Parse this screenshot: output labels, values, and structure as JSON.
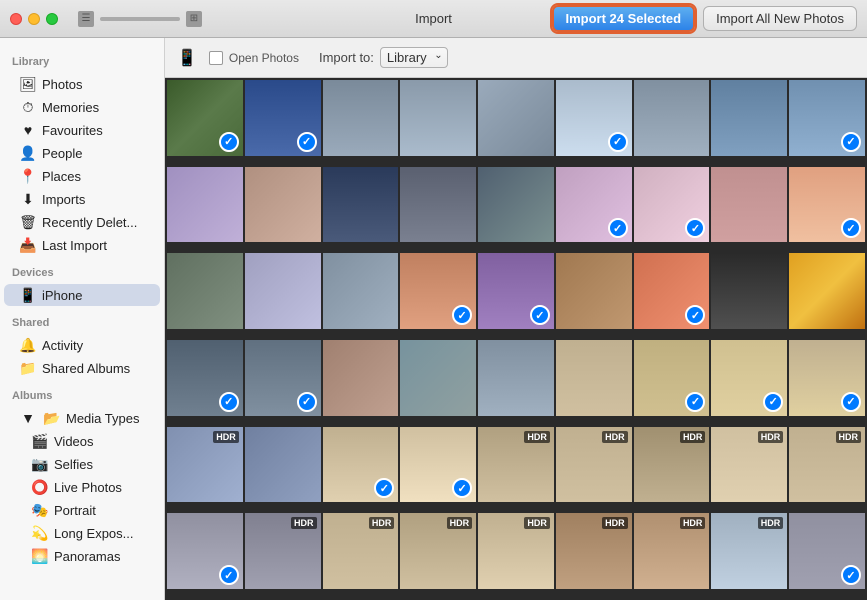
{
  "titlebar": {
    "title": "Import",
    "btn_import_selected": "Import 24 Selected",
    "btn_import_all": "Import All New Photos"
  },
  "toolbar": {
    "open_photos_label": "Open Photos",
    "import_to_label": "Import to:",
    "import_to_value": "Library",
    "device_label": "iPhone"
  },
  "sidebar": {
    "library_header": "Library",
    "library_items": [
      {
        "id": "photos",
        "icon": "🖼",
        "label": "Photos"
      },
      {
        "id": "memories",
        "icon": "⏱",
        "label": "Memories"
      },
      {
        "id": "favourites",
        "icon": "♥",
        "label": "Favourites"
      },
      {
        "id": "people",
        "icon": "👤",
        "label": "People"
      },
      {
        "id": "places",
        "icon": "📍",
        "label": "Places"
      },
      {
        "id": "imports",
        "icon": "⬇",
        "label": "Imports"
      },
      {
        "id": "recently-deleted",
        "icon": "🗑",
        "label": "Recently Delet..."
      },
      {
        "id": "last-import",
        "icon": "📥",
        "label": "Last Import"
      }
    ],
    "devices_header": "Devices",
    "device_items": [
      {
        "id": "iphone",
        "icon": "📱",
        "label": "iPhone"
      }
    ],
    "shared_header": "Shared",
    "shared_items": [
      {
        "id": "activity",
        "icon": "🔔",
        "label": "Activity"
      },
      {
        "id": "shared-albums",
        "icon": "📁",
        "label": "Shared Albums"
      }
    ],
    "albums_header": "Albums",
    "albums_items": [
      {
        "id": "media-types",
        "icon": "📂",
        "label": "Media Types",
        "disclosure": true
      },
      {
        "id": "videos",
        "icon": "🎬",
        "label": "Videos",
        "sub": true
      },
      {
        "id": "selfies",
        "icon": "📷",
        "label": "Selfies",
        "sub": true
      },
      {
        "id": "live-photos",
        "icon": "⭕",
        "label": "Live Photos",
        "sub": true
      },
      {
        "id": "portrait",
        "icon": "🎭",
        "label": "Portrait",
        "sub": true
      },
      {
        "id": "long-exposure",
        "icon": "💫",
        "label": "Long Expos...",
        "sub": true
      },
      {
        "id": "panoramas",
        "icon": "🌅",
        "label": "Panoramas",
        "sub": true
      }
    ]
  },
  "photos": [
    {
      "id": 1,
      "checked": true,
      "hdr": false
    },
    {
      "id": 2,
      "checked": true,
      "hdr": false
    },
    {
      "id": 3,
      "checked": false,
      "hdr": false
    },
    {
      "id": 4,
      "checked": false,
      "hdr": false
    },
    {
      "id": 5,
      "checked": false,
      "hdr": false
    },
    {
      "id": 6,
      "checked": true,
      "hdr": false
    },
    {
      "id": 7,
      "checked": false,
      "hdr": false
    },
    {
      "id": 8,
      "checked": false,
      "hdr": false
    },
    {
      "id": 9,
      "checked": true,
      "hdr": false
    },
    {
      "id": 10,
      "checked": false,
      "hdr": false
    },
    {
      "id": 11,
      "checked": false,
      "hdr": false
    },
    {
      "id": 12,
      "checked": false,
      "hdr": false
    },
    {
      "id": 13,
      "checked": false,
      "hdr": false
    },
    {
      "id": 14,
      "checked": false,
      "hdr": false
    },
    {
      "id": 15,
      "checked": true,
      "hdr": false
    },
    {
      "id": 16,
      "checked": true,
      "hdr": false
    },
    {
      "id": 17,
      "checked": false,
      "hdr": false
    },
    {
      "id": 18,
      "checked": true,
      "hdr": false
    },
    {
      "id": 19,
      "checked": false,
      "hdr": false
    },
    {
      "id": 20,
      "checked": false,
      "hdr": false
    },
    {
      "id": 21,
      "checked": false,
      "hdr": false
    },
    {
      "id": 22,
      "checked": true,
      "hdr": false
    },
    {
      "id": 23,
      "checked": true,
      "hdr": false
    },
    {
      "id": 24,
      "checked": false,
      "hdr": false
    },
    {
      "id": 25,
      "checked": true,
      "hdr": false
    },
    {
      "id": 26,
      "checked": false,
      "hdr": false
    },
    {
      "id": 27,
      "checked": false,
      "hdr": false
    },
    {
      "id": 28,
      "checked": true,
      "hdr": false
    },
    {
      "id": 29,
      "checked": true,
      "hdr": false
    },
    {
      "id": 30,
      "checked": false,
      "hdr": false
    },
    {
      "id": 31,
      "checked": false,
      "hdr": false
    },
    {
      "id": 32,
      "checked": false,
      "hdr": false
    },
    {
      "id": 33,
      "checked": false,
      "hdr": false
    },
    {
      "id": 34,
      "checked": true,
      "hdr": false
    },
    {
      "id": 35,
      "checked": true,
      "hdr": false
    },
    {
      "id": 36,
      "checked": true,
      "hdr": false
    },
    {
      "id": 37,
      "checked": false,
      "hdr": "HDR"
    },
    {
      "id": 38,
      "checked": false,
      "hdr": false
    },
    {
      "id": 39,
      "checked": true,
      "hdr": false
    },
    {
      "id": 40,
      "checked": true,
      "hdr": false
    },
    {
      "id": 41,
      "checked": false,
      "hdr": "HDR"
    },
    {
      "id": 42,
      "checked": false,
      "hdr": "HDR"
    },
    {
      "id": 43,
      "checked": false,
      "hdr": "HDR"
    },
    {
      "id": 44,
      "checked": false,
      "hdr": "HDR"
    },
    {
      "id": 45,
      "checked": false,
      "hdr": "HDR"
    },
    {
      "id": 46,
      "checked": true,
      "hdr": false
    },
    {
      "id": 47,
      "checked": false,
      "hdr": "HDR"
    },
    {
      "id": 48,
      "checked": false,
      "hdr": "HDR"
    },
    {
      "id": 49,
      "checked": false,
      "hdr": "HDR"
    },
    {
      "id": 50,
      "checked": false,
      "hdr": "HDR"
    },
    {
      "id": 51,
      "checked": false,
      "hdr": "HDR"
    },
    {
      "id": 52,
      "checked": false,
      "hdr": "HDR"
    },
    {
      "id": 53,
      "checked": false,
      "hdr": "HDR"
    },
    {
      "id": 54,
      "checked": true,
      "hdr": false
    }
  ]
}
